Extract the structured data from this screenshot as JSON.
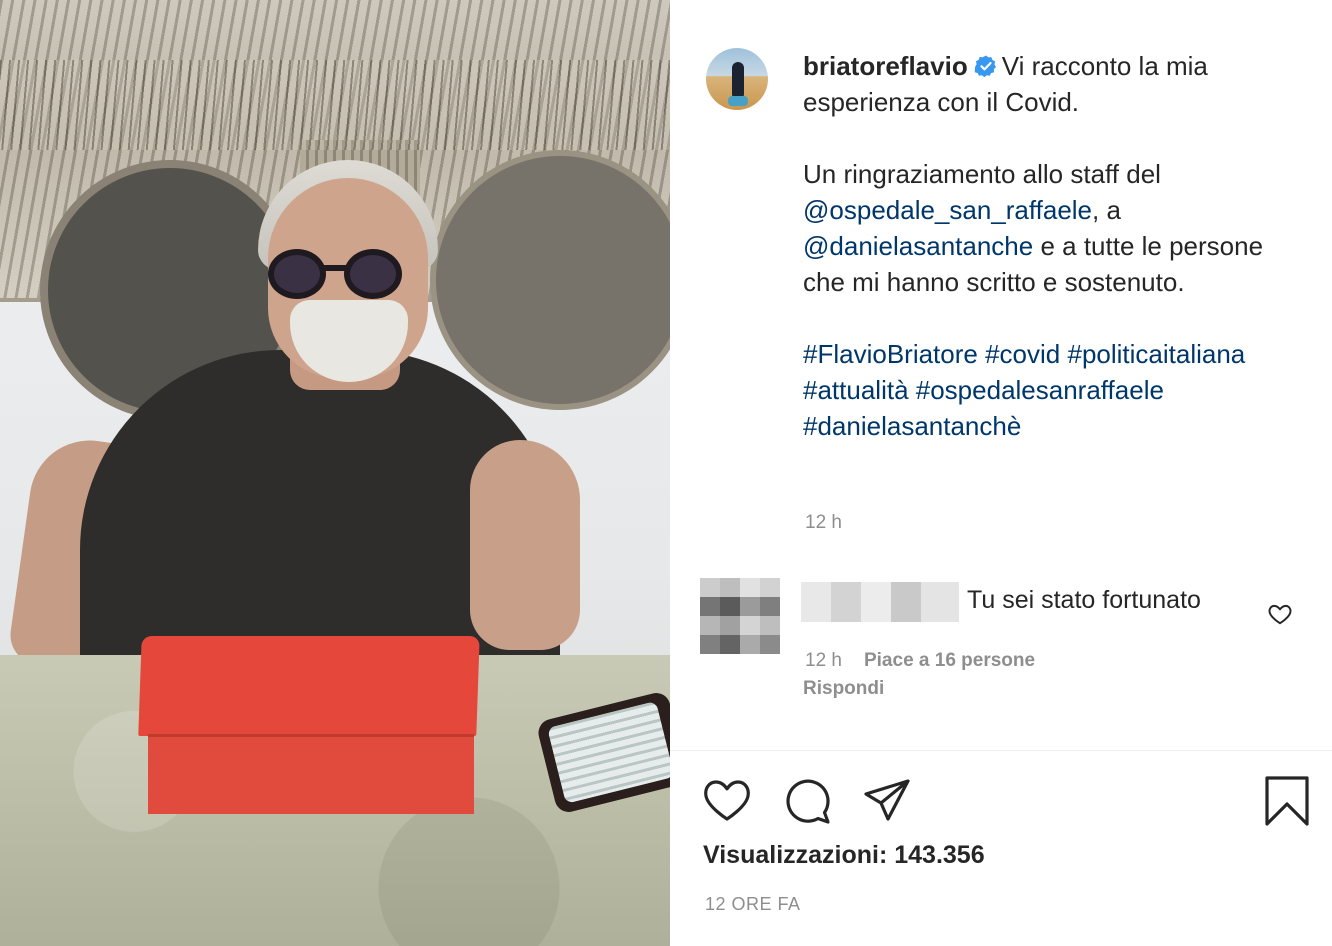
{
  "post": {
    "username": "briatoreflavio",
    "caption_intro": "Vi racconto la mia esperienza con il Covid.",
    "caption_line1": "Un ringraziamento allo staff del",
    "mention1": "@ospedale_san_raffaele",
    "caption_after_mention1": ", a",
    "mention2": "@danielasantanche",
    "caption_after_mention2": " e a tutte le persone che mi hanno scritto e sostenuto.",
    "hashtags": [
      "#FlavioBriatore",
      "#covid",
      "#politicaitaliana",
      "#attualità",
      "#ospedalesanraffaele",
      "#danielasantanchè"
    ],
    "time": "12 h"
  },
  "comment": {
    "text": "Tu sei stato fortunato",
    "time": "12 h",
    "likes": "Piace a 16 persone",
    "reply_label": "Rispondi"
  },
  "actions": {
    "like_icon": "heart-icon",
    "comment_icon": "comment-bubble-icon",
    "share_icon": "paper-plane-icon",
    "save_icon": "bookmark-icon"
  },
  "stats": {
    "views": "Visualizzazioni: 143.356",
    "posted": "12 ORE FA"
  },
  "colors": {
    "link": "#00376b",
    "muted": "#8e8e8e",
    "text": "#262626",
    "verified": "#3897f0"
  }
}
